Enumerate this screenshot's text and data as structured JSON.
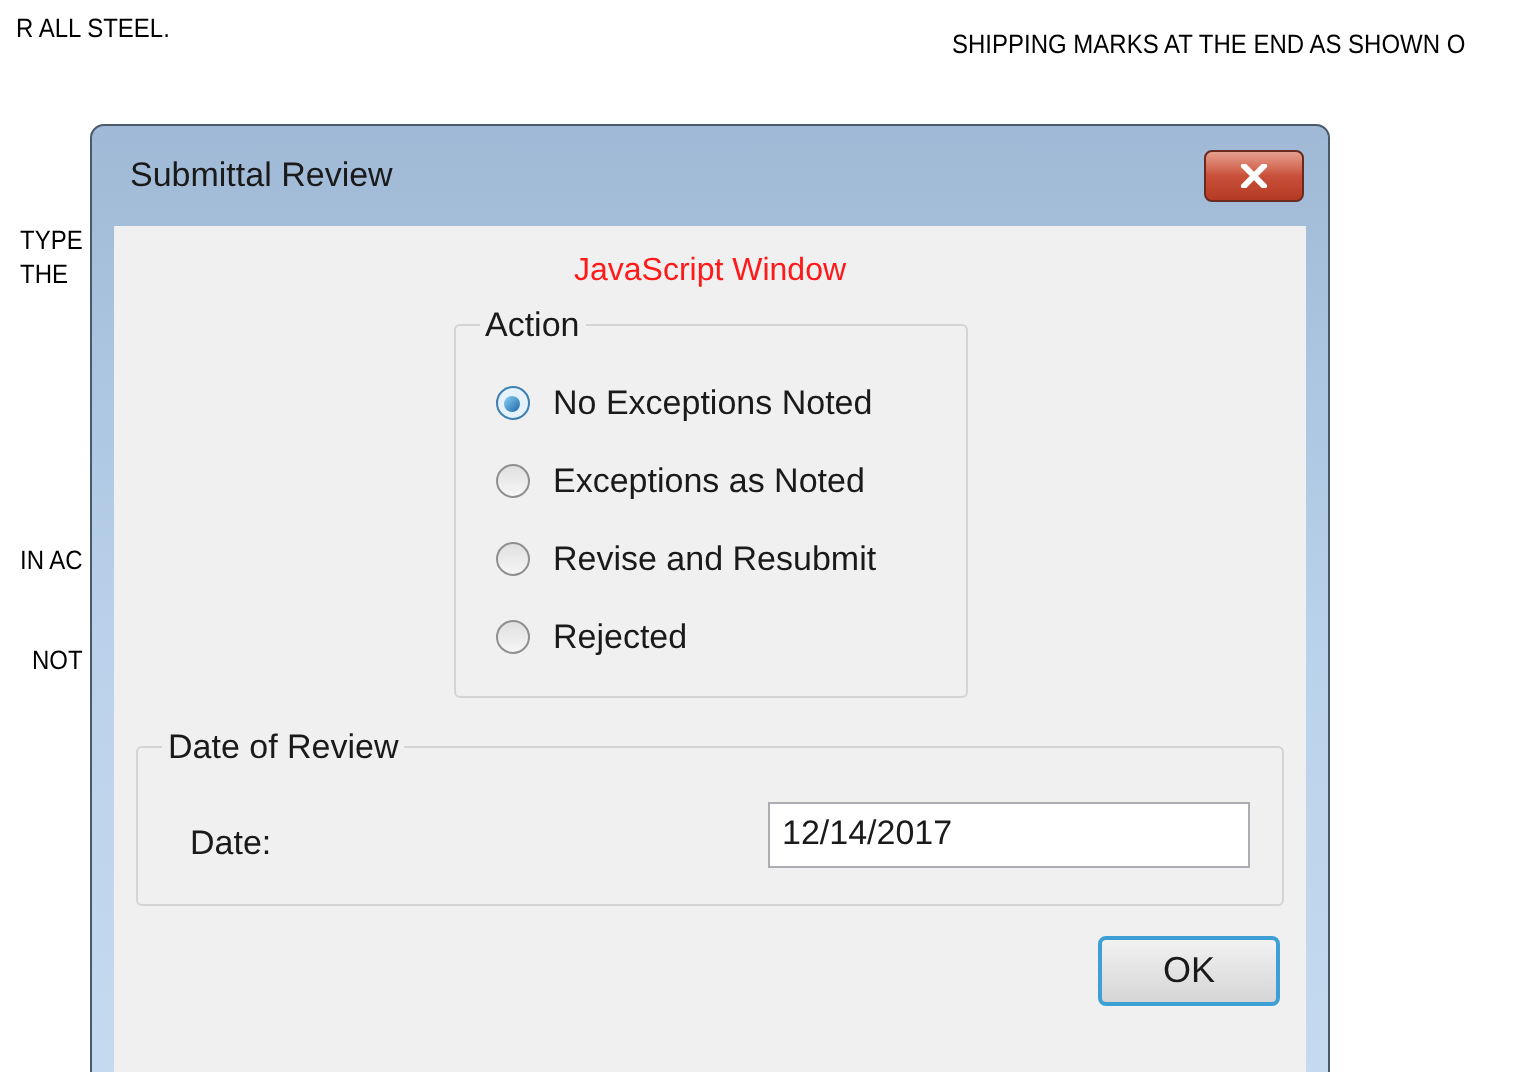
{
  "background_drawing": {
    "notes": [
      "R ALL STEEL.",
      "SHIPPING MARKS AT THE END AS SHOWN O",
      "TYPE",
      "THE",
      "IN AC",
      "NOT"
    ]
  },
  "dialog": {
    "title": "Submittal Review",
    "heading": "JavaScript Window",
    "action_group": {
      "label": "Action",
      "options": [
        {
          "label": "No Exceptions Noted",
          "selected": true
        },
        {
          "label": "Exceptions as Noted",
          "selected": false
        },
        {
          "label": "Revise and Resubmit",
          "selected": false
        },
        {
          "label": "Rejected",
          "selected": false
        }
      ]
    },
    "date_group": {
      "label": "Date of Review",
      "field_label": "Date:",
      "value": "12/14/2017"
    },
    "buttons": [
      "OK"
    ]
  }
}
